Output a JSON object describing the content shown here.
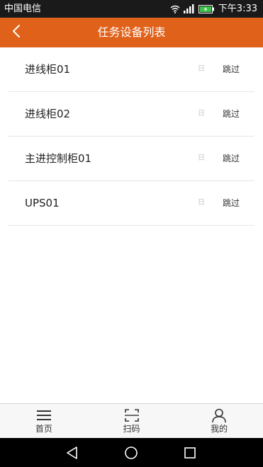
{
  "status_bar": {
    "carrier": "中国电信",
    "time": "下午3:33",
    "wifi_icon": "wifi-icon",
    "signal_icon": "cellular-signal-icon",
    "battery_icon": "battery-charging-icon"
  },
  "header": {
    "title": "任务设备列表",
    "back_icon": "chevron-left-icon",
    "background": "#e0621a"
  },
  "devices": [
    {
      "name": "进线柜01",
      "status": "日",
      "action": "跳过"
    },
    {
      "name": "进线柜02",
      "status": "日",
      "action": "跳过"
    },
    {
      "name": "主进控制柜01",
      "status": "日",
      "action": "跳过"
    },
    {
      "name": "UPS01",
      "status": "日",
      "action": "跳过"
    }
  ],
  "tabs": [
    {
      "label": "首页",
      "icon": "menu-icon"
    },
    {
      "label": "扫码",
      "icon": "scan-icon"
    },
    {
      "label": "我的",
      "icon": "user-icon"
    }
  ],
  "nav_bar": {
    "back_icon": "nav-back-icon",
    "home_icon": "nav-home-icon",
    "recents_icon": "nav-recents-icon"
  }
}
